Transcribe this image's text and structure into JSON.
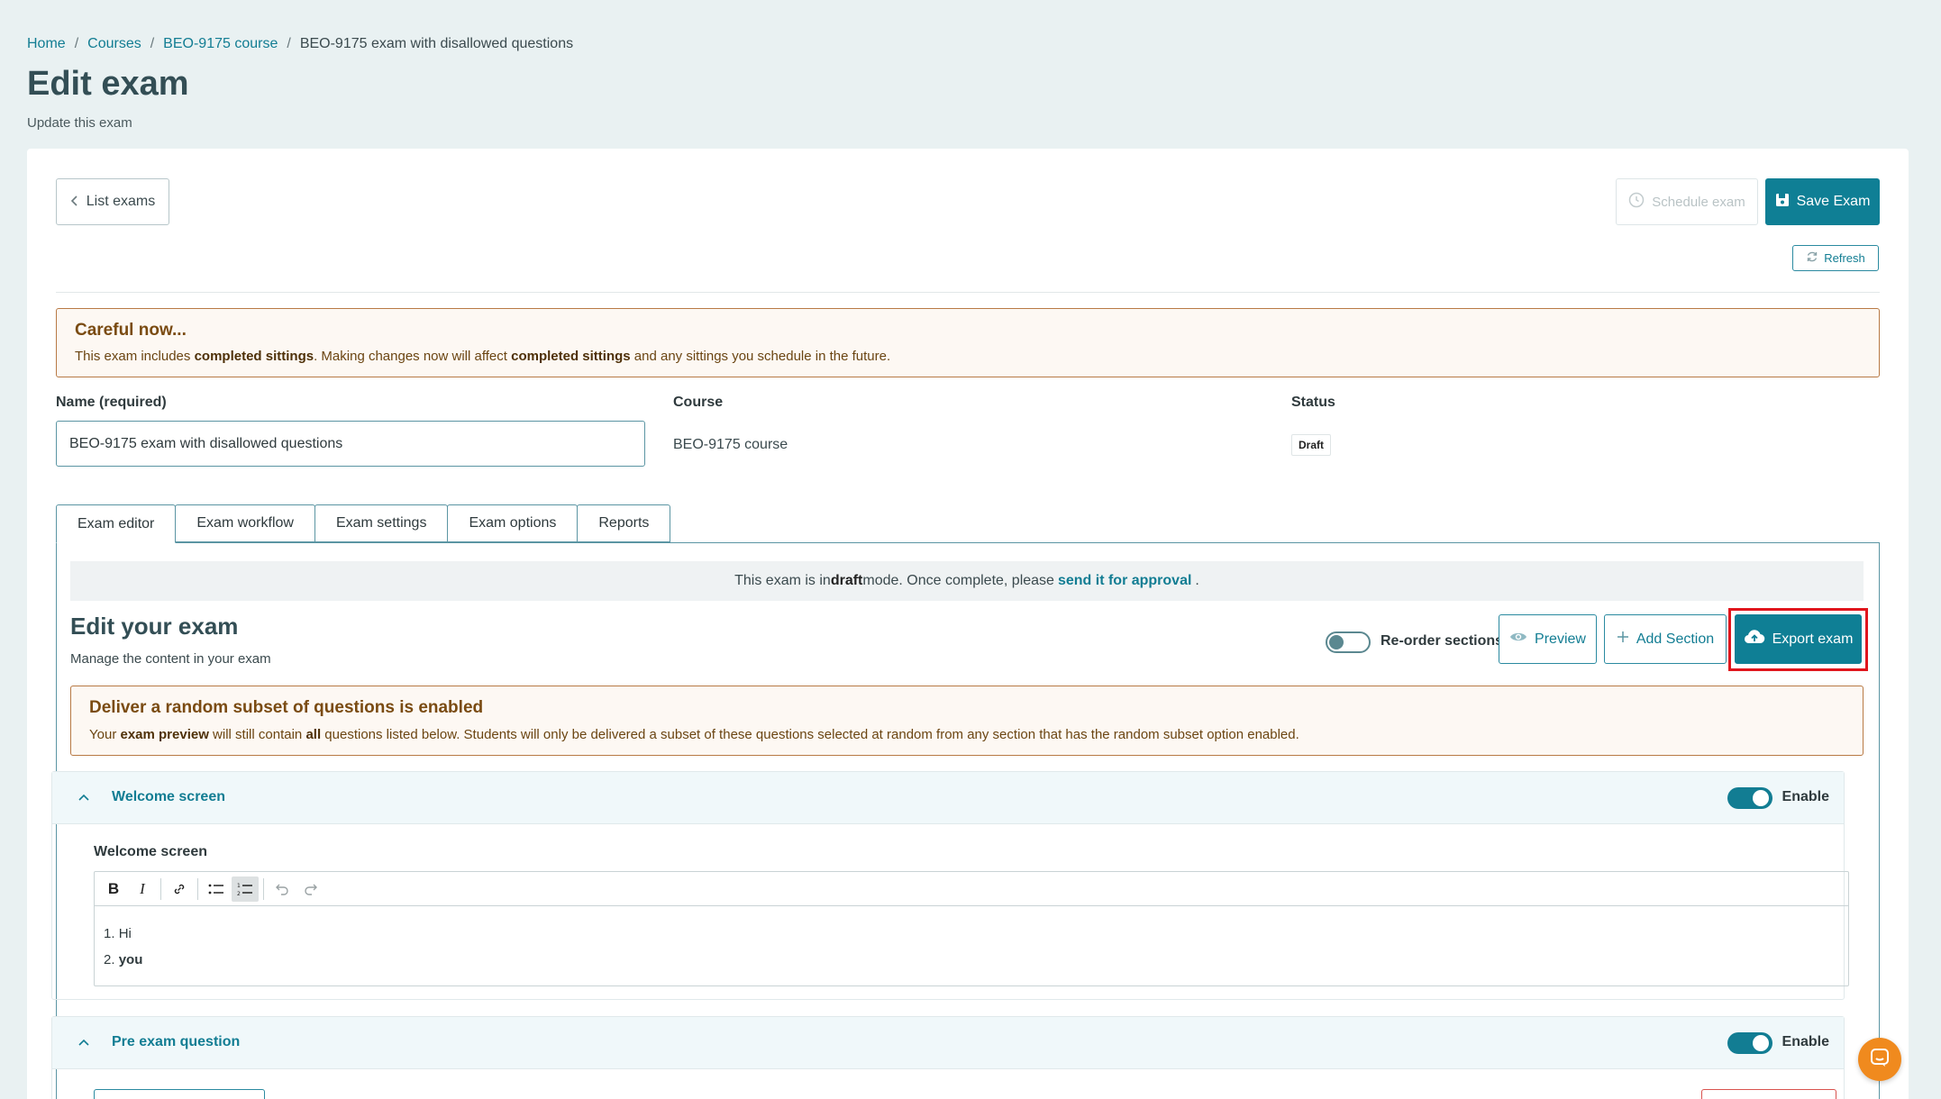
{
  "breadcrumb": {
    "home": "Home",
    "courses": "Courses",
    "course": "BEO-9175 course",
    "current": "BEO-9175 exam with disallowed questions",
    "separator": "/"
  },
  "page": {
    "title": "Edit exam",
    "subtitle": "Update this exam"
  },
  "toolbar": {
    "list_exams": "List exams",
    "schedule_exam": "Schedule exam",
    "save_exam": "Save Exam",
    "refresh": "Refresh"
  },
  "careful_alert": {
    "title": "Careful now...",
    "t1": "This exam includes ",
    "b1": "completed sittings",
    "t2": ". Making changes now will affect ",
    "b2": "completed sittings",
    "t3": " and any sittings you schedule in the future."
  },
  "form": {
    "name_label": "Name (required)",
    "name_value": "BEO-9175 exam with disallowed questions",
    "course_label": "Course",
    "course_value": "BEO-9175 course",
    "status_label": "Status",
    "status_value": "Draft"
  },
  "tabs": [
    {
      "label": "Exam editor"
    },
    {
      "label": "Exam workflow"
    },
    {
      "label": "Exam settings"
    },
    {
      "label": "Exam options"
    },
    {
      "label": "Reports"
    }
  ],
  "draft_info": {
    "t1": "This exam is in ",
    "b1": "draft",
    "t2": " mode. Once complete, please ",
    "link": "send it for approval",
    "t3": "."
  },
  "editor_section": {
    "title": "Edit your exam",
    "subtitle": "Manage the content in your exam",
    "reorder_label": "Re-order sections",
    "preview": "Preview",
    "add_section": "Add Section",
    "export_exam": "Export exam"
  },
  "random_alert": {
    "title": "Deliver a random subset of questions is enabled",
    "t1": "Your ",
    "b1": "exam preview",
    "t2": " will still contain ",
    "b2": "all",
    "t3": " questions listed below. Students will only be delivered a subset of these questions selected at random from any section that has the random subset option enabled."
  },
  "panels": {
    "welcome": {
      "title": "Welcome screen",
      "enable_label": "Enable"
    },
    "pre_exam": {
      "title": "Pre exam question",
      "enable_label": "Enable"
    }
  },
  "welcome_editor": {
    "label": "Welcome screen",
    "items": [
      {
        "num": "1.",
        "text": "Hi"
      },
      {
        "num": "2.",
        "text": "you"
      }
    ]
  },
  "icons": [
    "chevron-left-icon",
    "clock-icon",
    "save-icon",
    "refresh-icon",
    "eye-icon",
    "plus-icon",
    "cloud-upload-icon",
    "chevron-up-icon",
    "chat-icon"
  ],
  "colors": {
    "primary": "#0f7f95",
    "alert_border": "#b87a45",
    "background": "#e9f1f2",
    "highlight": "#e0161d",
    "chat": "#f08a1e"
  }
}
